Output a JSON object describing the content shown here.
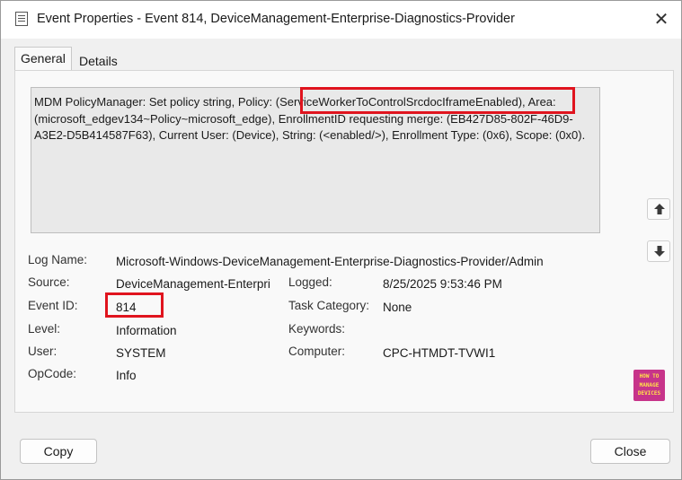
{
  "window": {
    "title": "Event Properties - Event 814, DeviceManagement-Enterprise-Diagnostics-Provider",
    "close_glyph": "✕"
  },
  "tabs": [
    {
      "label": "General",
      "active": true
    },
    {
      "label": "Details",
      "active": false
    }
  ],
  "description": "MDM PolicyManager: Set policy string, Policy: (ServiceWorkerToControlSrcdocIframeEnabled), Area: (microsoft_edgev134~Policy~microsoft_edge), EnrollmentID requesting merge: (EB427D85-802F-46D9-A3E2-D5B414587F63), Current User: (Device), String: (<enabled/>), Enrollment Type: (0x6), Scope: (0x0).",
  "fields": {
    "log_name_label": "Log Name:",
    "log_name": "Microsoft-Windows-DeviceManagement-Enterprise-Diagnostics-Provider/Admin",
    "source_label": "Source:",
    "source": "DeviceManagement-Enterpri",
    "logged_label": "Logged:",
    "logged": "8/25/2025 9:53:46 PM",
    "event_id_label": "Event ID:",
    "event_id": "814",
    "task_category_label": "Task Category:",
    "task_category": "None",
    "level_label": "Level:",
    "level": "Information",
    "keywords_label": "Keywords:",
    "keywords": "",
    "user_label": "User:",
    "user": "SYSTEM",
    "computer_label": "Computer:",
    "computer": "CPC-HTMDT-TVWI1",
    "opcode_label": "OpCode:",
    "opcode": "Info"
  },
  "side_buttons": {
    "up_icon": "arrow-up-icon",
    "down_icon": "arrow-down-icon"
  },
  "logo": {
    "line1": "HOW TO",
    "line2": "MANAGE",
    "line3": "DEVICES"
  },
  "buttons": {
    "copy": "Copy",
    "close": "Close"
  },
  "colors": {
    "highlight": "#e0141e",
    "logo_bg": "#c7348a",
    "logo_text": "#ffe14a"
  }
}
